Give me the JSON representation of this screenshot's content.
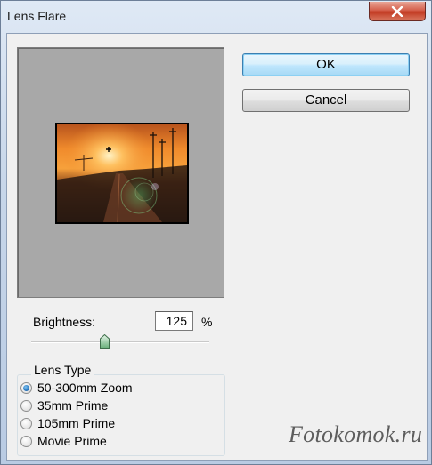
{
  "window": {
    "title": "Lens Flare"
  },
  "buttons": {
    "ok_label": "OK",
    "cancel_label": "Cancel"
  },
  "brightness": {
    "label": "Brightness:",
    "value": "125",
    "unit": "%",
    "slider_fraction": 0.41
  },
  "lens_type": {
    "legend": "Lens Type",
    "options": [
      {
        "label": "50-300mm Zoom",
        "checked": true
      },
      {
        "label": "35mm Prime",
        "checked": false
      },
      {
        "label": "105mm Prime",
        "checked": false
      },
      {
        "label": "Movie Prime",
        "checked": false
      }
    ]
  },
  "watermark": "Fotokomok.ru",
  "colors": {
    "close_button": "#c23a22",
    "default_button_border": "#3c7fb1",
    "preview_bg": "#a8a8a8",
    "dialog_bg": "#f0f0f0"
  },
  "icons": {
    "close": "close-x-icon",
    "flare_center": "crosshair-icon",
    "slider_thumb": "slider-thumb-icon"
  }
}
